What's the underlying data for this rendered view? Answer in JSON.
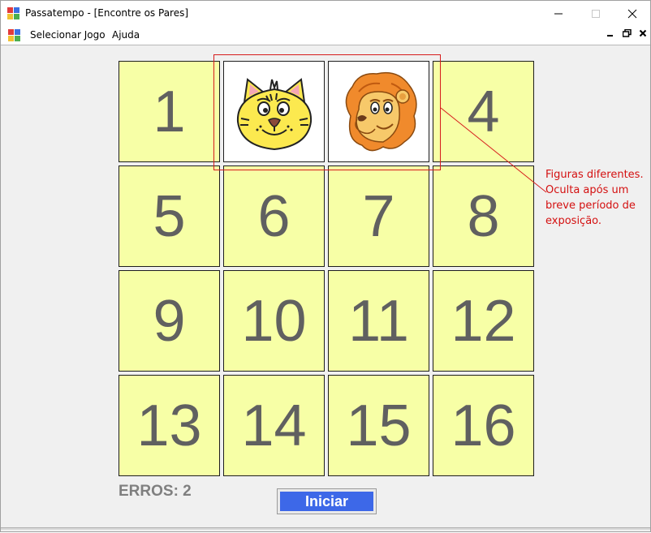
{
  "window": {
    "title": "Passatempo - [Encontre os Pares]",
    "minimize_icon": "minimize-icon",
    "maximize_icon": "maximize-icon",
    "close_icon": "close-icon"
  },
  "menu": {
    "items": [
      {
        "label": "Selecionar Jogo"
      },
      {
        "label": "Ajuda"
      }
    ],
    "mdi_minimize": "_",
    "mdi_restore": "🗗",
    "mdi_close": "✕"
  },
  "board": {
    "tiles": [
      {
        "label": "1",
        "state": "hidden"
      },
      {
        "label": "",
        "state": "revealed",
        "icon": "cat-face-icon"
      },
      {
        "label": "",
        "state": "revealed",
        "icon": "lion-face-icon"
      },
      {
        "label": "4",
        "state": "hidden"
      },
      {
        "label": "5",
        "state": "hidden"
      },
      {
        "label": "6",
        "state": "hidden"
      },
      {
        "label": "7",
        "state": "hidden"
      },
      {
        "label": "8",
        "state": "hidden"
      },
      {
        "label": "9",
        "state": "hidden"
      },
      {
        "label": "10",
        "state": "hidden"
      },
      {
        "label": "11",
        "state": "hidden"
      },
      {
        "label": "12",
        "state": "hidden"
      },
      {
        "label": "13",
        "state": "hidden"
      },
      {
        "label": "14",
        "state": "hidden"
      },
      {
        "label": "15",
        "state": "hidden"
      },
      {
        "label": "16",
        "state": "hidden"
      }
    ],
    "tile_color": "#f7ffa6",
    "number_color": "#606060"
  },
  "annotation": {
    "line1": "Figuras diferentes.",
    "line2": "Oculta após um",
    "line3": "breve período de",
    "line4": "exposição.",
    "color": "#d41010"
  },
  "status": {
    "erros_label": "ERROS: 2"
  },
  "actions": {
    "start_label": "Iniciar",
    "start_color": "#3d68e8"
  }
}
